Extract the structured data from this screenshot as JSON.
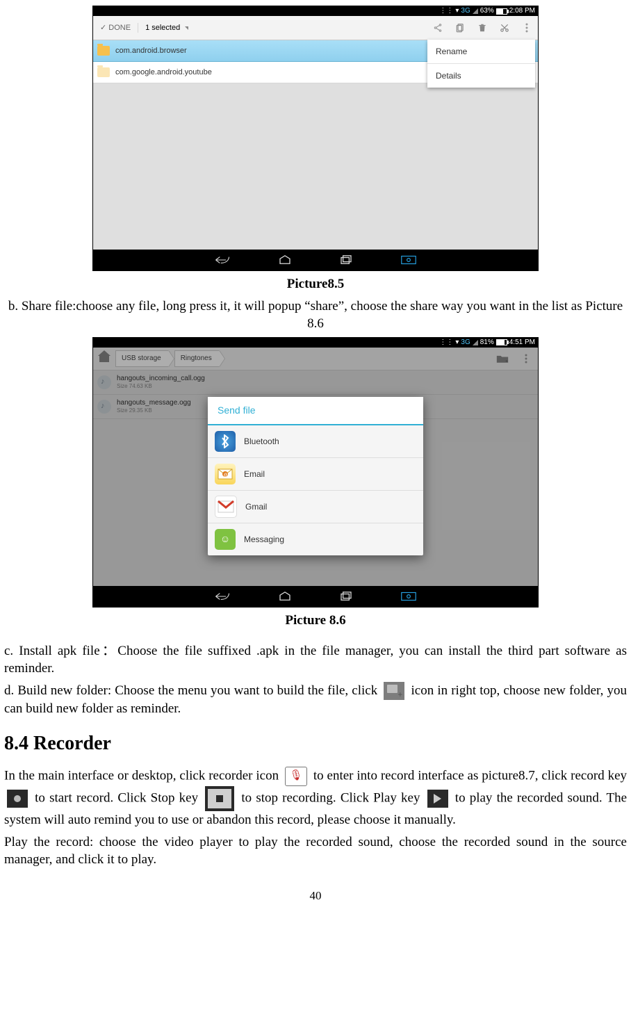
{
  "page_number": "40",
  "caption_1": "Picture8.5",
  "caption_2": "Picture 8.6",
  "para_b": "b. Share file:choose any file, long press it, it will popup “share”, choose the share way you want in the list as Picture 8.6",
  "para_c": "c. Install apk file：Choose the file suffixed .apk in the file manager, you can install the third part software as reminder.",
  "para_d_1": "d. Build new folder: Choose the menu you want to build the file, click ",
  "para_d_2": " icon in right top, choose new folder, you can build new folder as reminder.",
  "section_title": "8.4 Recorder",
  "rec_1": "In the main interface or desktop, click recorder icon ",
  "rec_2": " to enter into record interface as picture8.7, click record key ",
  "rec_3": " to start record. Click Stop key ",
  "rec_4": " to stop recording. Click Play key ",
  "rec_5": " to play the recorded sound. The system will auto remind you to use or abandon this record, please choose it manually.",
  "rec_6": "Play the record: choose the video player to play the recorded sound, choose the recorded sound in the source manager, and click it to play.",
  "shot1": {
    "status": {
      "threeg": "3G",
      "sig_icon": "signal",
      "batt_pct": "63%",
      "time": "2:08 PM"
    },
    "done": "✓  DONE",
    "selected": "1 selected",
    "rows": [
      {
        "name": "com.android.browser",
        "highlight": true
      },
      {
        "name": "com.google.android.youtube",
        "highlight": false
      }
    ],
    "menu": [
      "Rename",
      "Details"
    ]
  },
  "shot2": {
    "status": {
      "threeg": "3G",
      "sig_icon": "signal",
      "batt_pct": "81%",
      "time": "4:51 PM"
    },
    "breadcrumbs": [
      "USB storage",
      "Ringtones"
    ],
    "files": [
      {
        "name": "hangouts_incoming_call.ogg",
        "size": "Size 74.63 KB"
      },
      {
        "name": "hangouts_message.ogg",
        "size": "Size 29.35 KB"
      }
    ],
    "dialog_title": "Send file",
    "dialog_items": [
      "Bluetooth",
      "Email",
      "Gmail",
      "Messaging"
    ]
  }
}
